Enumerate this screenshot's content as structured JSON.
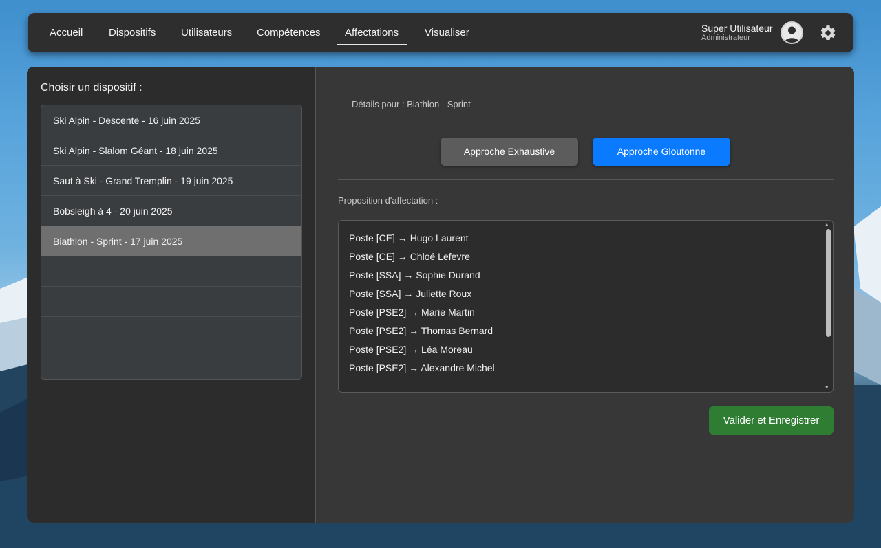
{
  "nav": {
    "items": [
      {
        "label": "Accueil"
      },
      {
        "label": "Dispositifs"
      },
      {
        "label": "Utilisateurs"
      },
      {
        "label": "Compétences"
      },
      {
        "label": "Affectations"
      },
      {
        "label": "Visualiser"
      }
    ],
    "active": "Affectations",
    "user_name": "Super Utilisateur",
    "user_role": "Administrateur"
  },
  "sidebar": {
    "title": "Choisir un dispositif :",
    "items": [
      {
        "label": "Ski Alpin - Descente - 16 juin 2025"
      },
      {
        "label": "Ski Alpin - Slalom Géant - 18 juin 2025"
      },
      {
        "label": "Saut à Ski - Grand Tremplin - 19 juin 2025"
      },
      {
        "label": "Bobsleigh à 4 - 20 juin 2025"
      },
      {
        "label": "Biathlon - Sprint - 17 juin 2025"
      }
    ],
    "selected_index": 4
  },
  "main": {
    "details_label": "Détails pour : Biathlon - Sprint",
    "btn_exhaustive": "Approche Exhaustive",
    "btn_gloutonne": "Approche Gloutonne",
    "proposition_label": "Proposition d'affectation :",
    "assignments": [
      "Poste [CE] → Hugo Laurent",
      "Poste [CE] → Chloé Lefevre",
      "Poste [SSA] → Sophie Durand",
      "Poste [SSA] → Juliette Roux",
      "Poste [PSE2] → Marie Martin",
      "Poste [PSE2] → Thomas Bernard",
      "Poste [PSE2] → Léa Moreau",
      "Poste [PSE2] → Alexandre Michel"
    ],
    "save_label": "Valider et Enregistrer"
  },
  "colors": {
    "accent_blue": "#0a7bff",
    "save_green": "#2e7d32",
    "panel_dark": "#2c2c2c"
  },
  "icons": {
    "avatar": "user-avatar-icon",
    "settings": "gear-icon"
  }
}
